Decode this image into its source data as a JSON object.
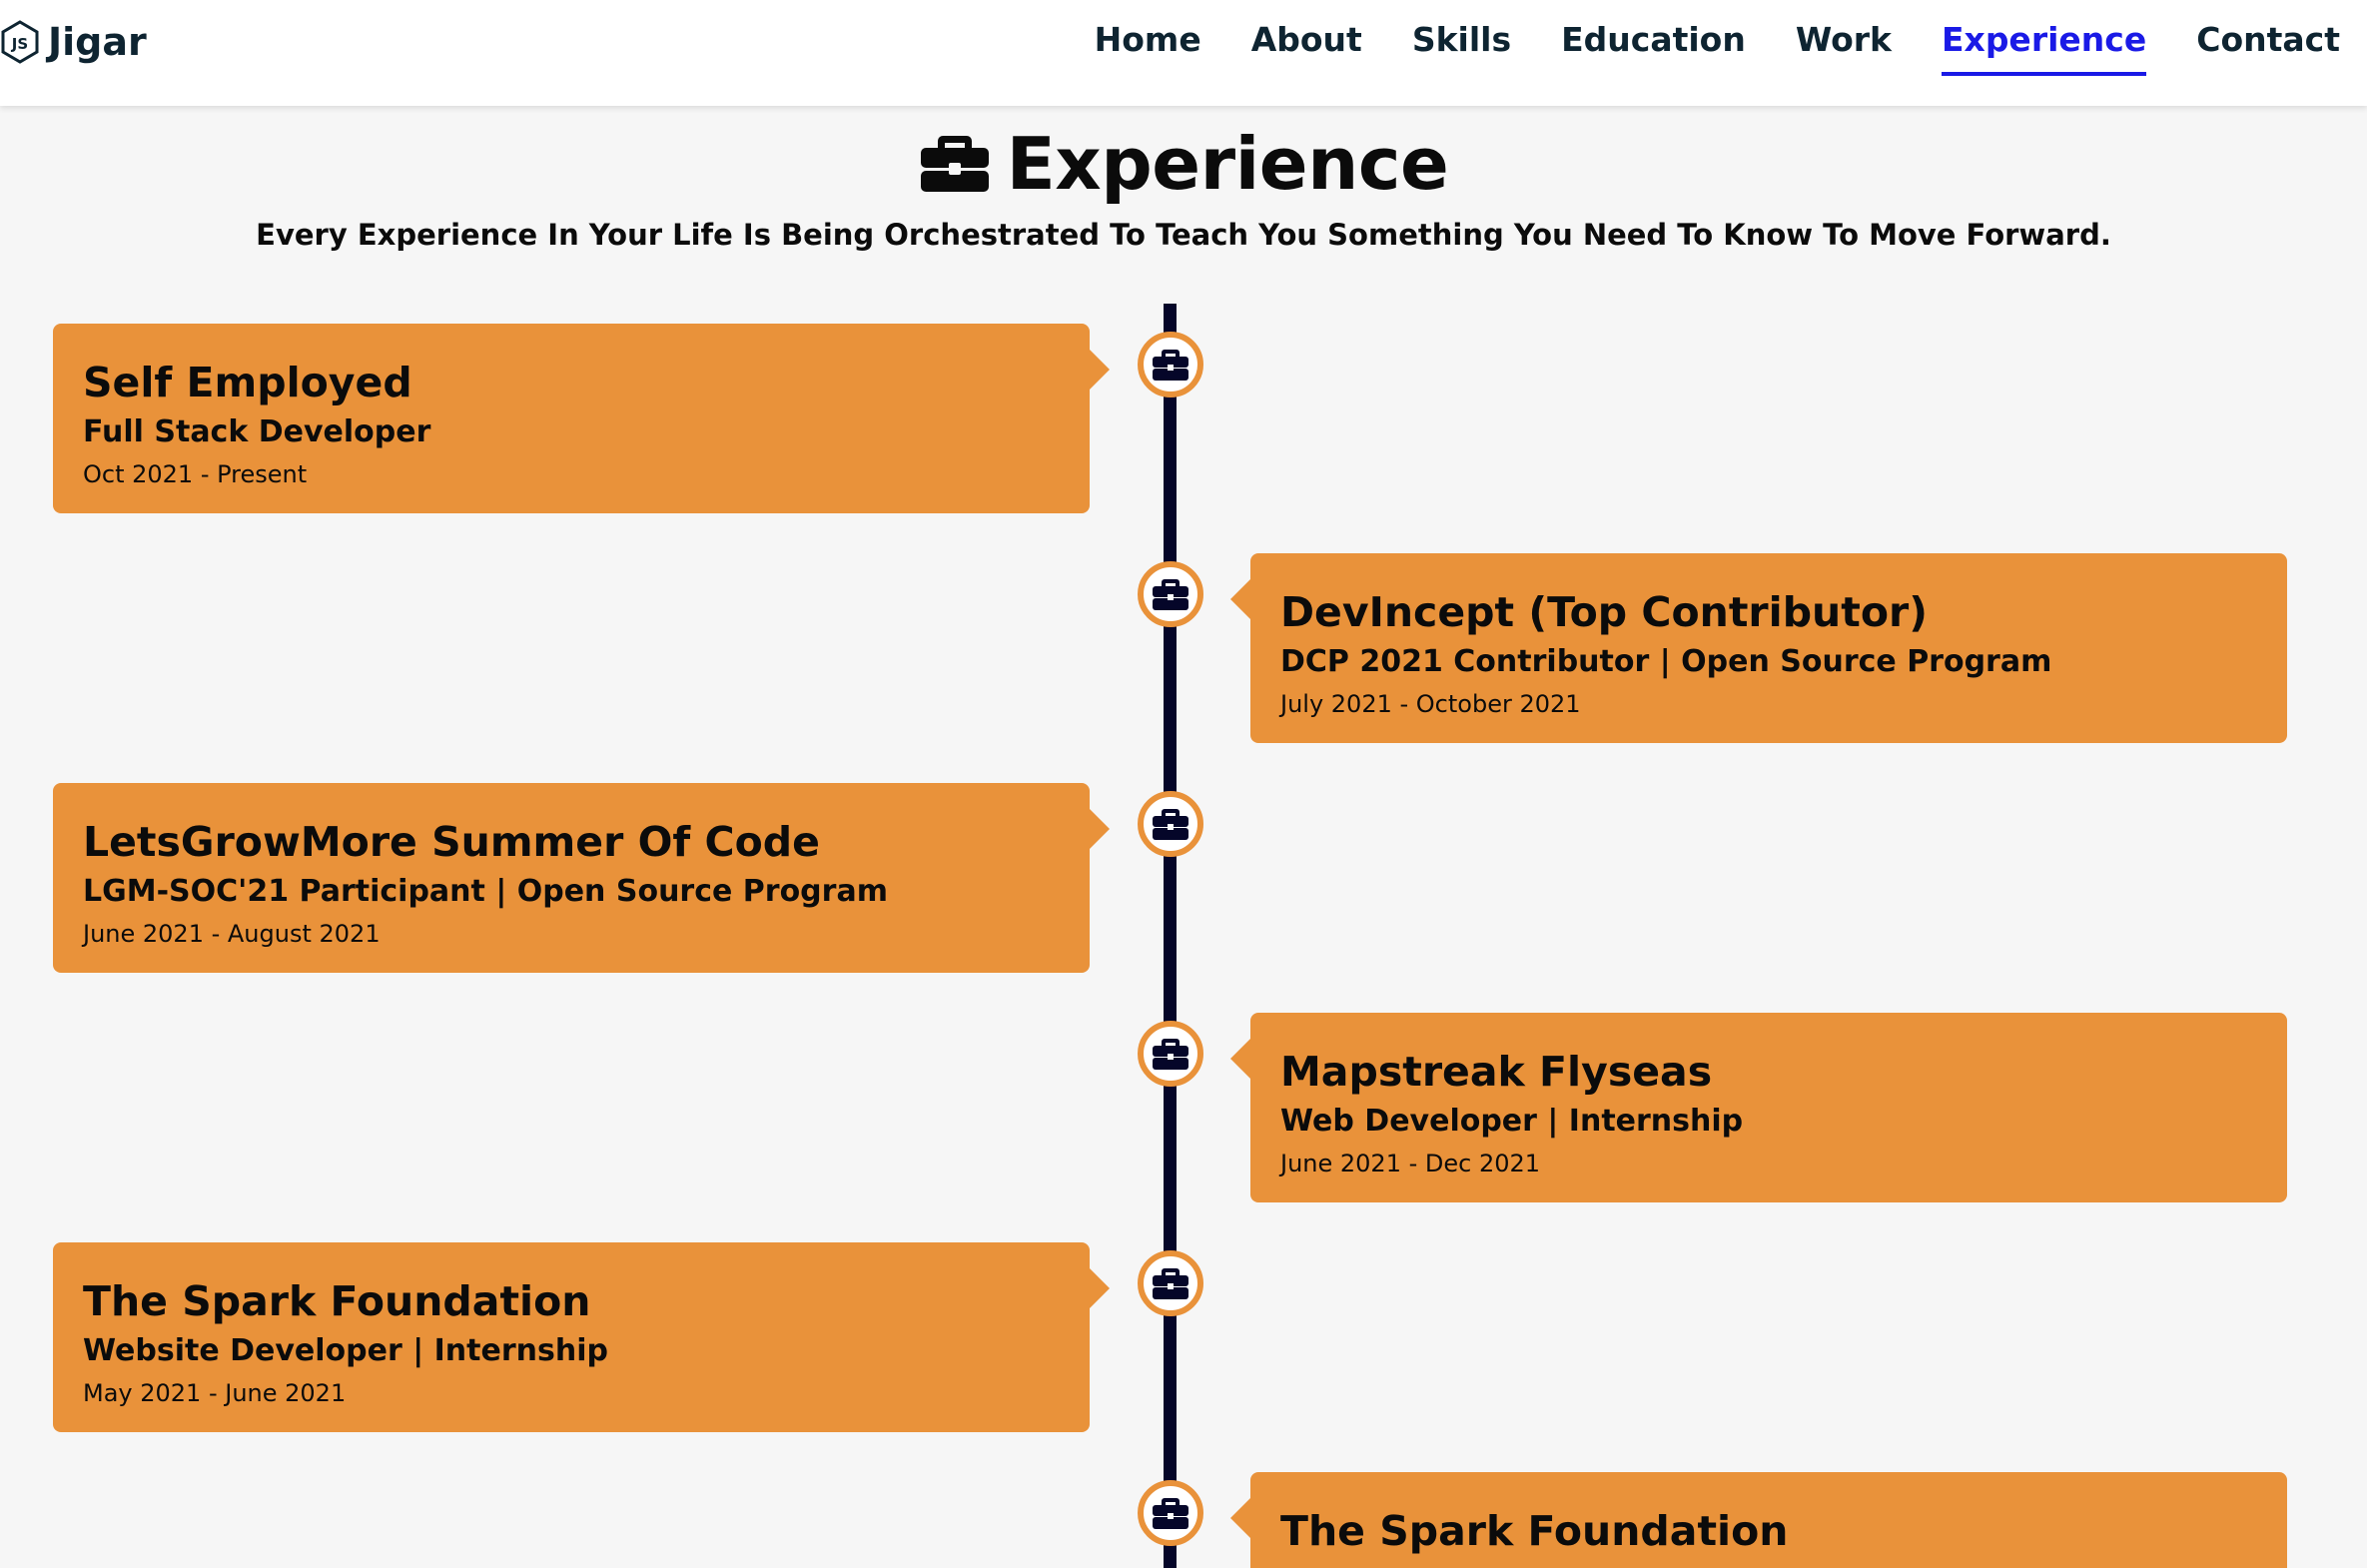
{
  "header": {
    "logo_text": "Jigar",
    "logo_icon": "nodejs-hexagon-icon",
    "nav": [
      {
        "label": "Home",
        "active": false
      },
      {
        "label": "About",
        "active": false
      },
      {
        "label": "Skills",
        "active": false
      },
      {
        "label": "Education",
        "active": false
      },
      {
        "label": "Work",
        "active": false
      },
      {
        "label": "Experience",
        "active": true
      },
      {
        "label": "Contact",
        "active": false
      }
    ]
  },
  "section": {
    "icon": "briefcase-icon",
    "title": "Experience",
    "quote": "Every Experience In Your Life Is Being Orchestrated To Teach You Something You Need To Know To Move Forward."
  },
  "experience": [
    {
      "company": "Self Employed",
      "role": "Full Stack Developer",
      "dates": "Oct 2021 - Present",
      "side": "left"
    },
    {
      "company": "DevIncept (Top Contributor)",
      "role": "DCP 2021 Contributor | Open Source Program",
      "dates": "July 2021 - October 2021",
      "side": "right"
    },
    {
      "company": "LetsGrowMore Summer Of Code",
      "role": "LGM-SOC'21 Participant | Open Source Program",
      "dates": "June 2021 - August 2021",
      "side": "left"
    },
    {
      "company": "Mapstreak Flyseas",
      "role": "Web Developer | Internship",
      "dates": "June 2021 - Dec 2021",
      "side": "right"
    },
    {
      "company": "The Spark Foundation",
      "role": "Website Developer | Internship",
      "dates": "May 2021 - June 2021",
      "side": "left"
    },
    {
      "company": "The Spark Foundation",
      "role": "",
      "dates": "",
      "side": "right"
    }
  ],
  "colors": {
    "accent": "#e9923a",
    "nav_active": "#1a1ae6",
    "nav_text": "#0e2431",
    "timeline": "#050629",
    "node_icon": "#050629",
    "background": "#f6f6f6"
  }
}
